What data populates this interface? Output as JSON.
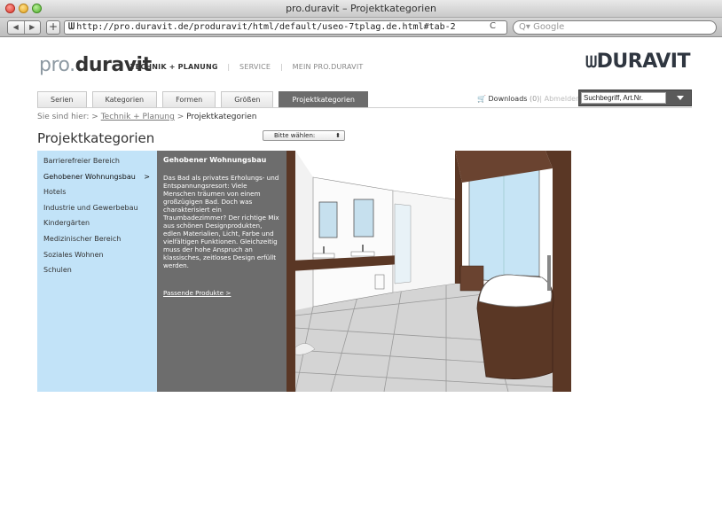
{
  "browser": {
    "window_title": "pro.duravit – Projektkategorien",
    "nav_back": "◀",
    "nav_forward": "▶",
    "add_label": "+",
    "url": "http://pro.duravit.de/produravit/html/default/useo-7tplag.de.html#tab-2",
    "reload_label": "C",
    "search_placeholder": "Q▾ Google"
  },
  "header": {
    "logo_prefix": "pro.",
    "logo_name": "duravit",
    "nav": [
      {
        "label": "TECHNIK + PLANUNG"
      },
      {
        "label": "SERVICE"
      },
      {
        "label": "MEIN PRO.DURAVIT"
      }
    ],
    "separator": "|",
    "brand_mark": "ᗯ",
    "brand_name": "DURAVIT"
  },
  "tabs": [
    {
      "label": "Serien"
    },
    {
      "label": "Kategorien"
    },
    {
      "label": "Formen"
    },
    {
      "label": "Größen"
    },
    {
      "label": "Projektkategorien"
    }
  ],
  "downloads": {
    "label": "Downloads",
    "count": "(0)",
    "logout": "Abmelden"
  },
  "search": {
    "placeholder": "Suchbegriff, Art.Nr."
  },
  "breadcrumb": {
    "prefix": "Sie sind hier:",
    "sep1": ">",
    "link": "Technik + Planung",
    "sep2": ">",
    "current": "Projektkategorien"
  },
  "page": {
    "title": "Projektkategorien",
    "select_value": "Bitte wählen:",
    "select_arrow": "⬍"
  },
  "categories": [
    {
      "label": "Barrierefreier Bereich"
    },
    {
      "label": "Gehobener Wohnungsbau"
    },
    {
      "label": "Hotels"
    },
    {
      "label": "Industrie und Gewerbebau"
    },
    {
      "label": "Kindergärten"
    },
    {
      "label": "Medizinischer Bereich"
    },
    {
      "label": "Soziales Wohnen"
    },
    {
      "label": "Schulen"
    }
  ],
  "active_chevron": ">",
  "detail": {
    "title": "Gehobener Wohnungsbau",
    "text": "Das Bad als privates Erholungs- und Entspannungsresort: Viele Menschen träumen von einem großzügigen Bad. Doch was charakterisiert ein Traumbadezimmer? Der richtige Mix aus schönen Designprodukten, edlen Materialien, Licht, Farbe und vielfältigen Funktionen. Gleichzeitig muss der hohe Anspruch an klassisches, zeitloses Design erfüllt werden.",
    "link": "Passende Produkte >"
  },
  "colors": {
    "leftnav_bg": "#c2e3f8",
    "detail_bg": "#6d6d6d",
    "wood": "#5a3725",
    "active_tab": "#6c6c6c"
  }
}
